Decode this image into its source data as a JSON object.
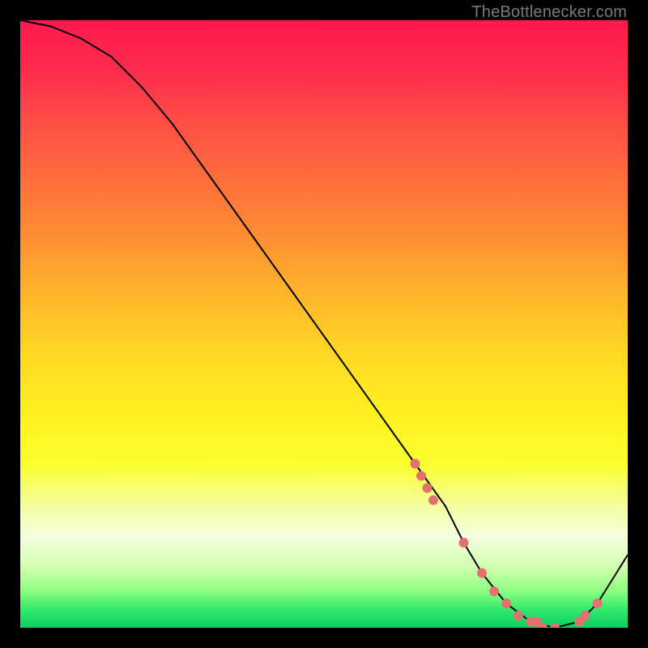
{
  "watermark": "TheBottlenecker.com",
  "chart_data": {
    "type": "line",
    "title": "",
    "xlabel": "",
    "ylabel": "",
    "xlim": [
      0,
      100
    ],
    "ylim": [
      0,
      100
    ],
    "x": [
      0,
      5,
      10,
      15,
      20,
      25,
      30,
      35,
      40,
      45,
      50,
      55,
      60,
      65,
      70,
      73,
      76,
      80,
      84,
      88,
      92,
      95,
      100
    ],
    "values": [
      100,
      99,
      97,
      94,
      89,
      83,
      76,
      69,
      62,
      55,
      48,
      41,
      34,
      27,
      20,
      14,
      9,
      4,
      1,
      0,
      1,
      4,
      12
    ],
    "markers": {
      "x": [
        65,
        66,
        67,
        68,
        73,
        76,
        78,
        80,
        82,
        84,
        85,
        86,
        88,
        92,
        93,
        95
      ],
      "values": [
        27,
        25,
        23,
        21,
        14,
        9,
        6,
        4,
        2,
        1,
        1,
        0,
        0,
        1,
        2,
        4
      ],
      "color": "#e2716f",
      "size": 6
    },
    "line_color": "#000000",
    "line_width": 2
  }
}
